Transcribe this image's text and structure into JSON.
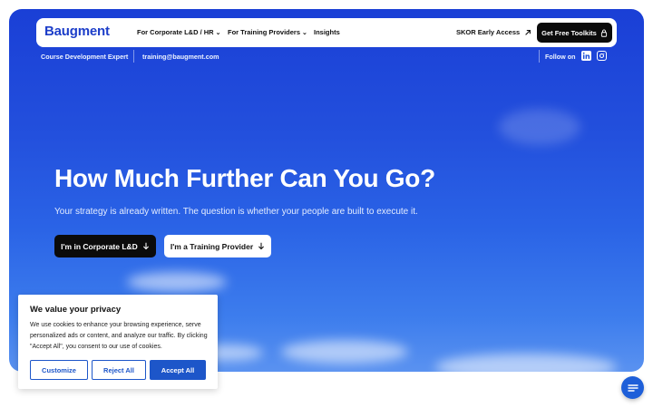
{
  "nav": {
    "logo": "Baugment",
    "items": [
      {
        "label": "For Corporate L&D / HR",
        "has_dropdown": true
      },
      {
        "label": "For Training Providers",
        "has_dropdown": true
      },
      {
        "label": "Insights",
        "has_dropdown": false
      }
    ],
    "early_access": {
      "label": "SKOR Early Access",
      "icon": "arrow-up-right-icon"
    },
    "cta": {
      "label": "Get Free Toolkits",
      "icon": "lock-icon"
    }
  },
  "subbar": {
    "tagline": "Course Development Expert",
    "email": "training@baugment.com",
    "follow_label": "Follow on",
    "social": [
      "linkedin-icon",
      "instagram-icon"
    ]
  },
  "hero": {
    "headline": "How Much Further Can You Go?",
    "subline": "Your strategy is already written. The question is whether your people are built to execute it.",
    "primary_button": "I'm in Corporate L&D",
    "secondary_button": "I'm a Training Provider"
  },
  "cookie": {
    "title": "We value your privacy",
    "text": "We use cookies to enhance your browsing experience, serve personalized ads or content, and analyze our traffic. By clicking \"Accept All\", you consent to our use of cookies.",
    "customize": "Customize",
    "reject": "Reject All",
    "accept": "Accept All"
  },
  "colors": {
    "brand": "#1d3ec9",
    "accent": "#1d56c9",
    "dark": "#0b0b0b"
  }
}
